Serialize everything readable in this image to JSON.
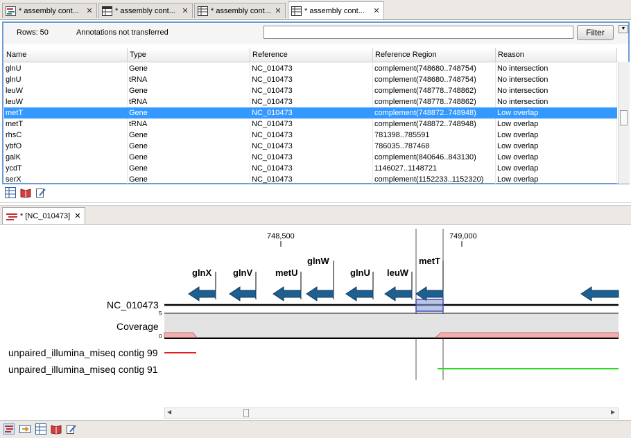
{
  "tabs": [
    {
      "label": "* assembly cont...",
      "icon": "assembly-icon"
    },
    {
      "label": "* assembly cont...",
      "icon": "table-icon"
    },
    {
      "label": "* assembly cont...",
      "icon": "table-icon"
    },
    {
      "label": "* assembly cont...",
      "icon": "table-icon"
    }
  ],
  "toolbar": {
    "rows": "Rows: 50",
    "annotations": "Annotations not transferred",
    "filter_value": "",
    "filter_label": "Filter",
    "menu_glyph": "▼"
  },
  "table": {
    "columns": [
      "Name",
      "Type",
      "Reference",
      "Reference Region",
      "Reason"
    ],
    "rows": [
      [
        "glnU",
        "Gene",
        "NC_010473",
        "complement(748680..748754)",
        "No intersection"
      ],
      [
        "glnU",
        "tRNA",
        "NC_010473",
        "complement(748680..748754)",
        "No intersection"
      ],
      [
        "leuW",
        "Gene",
        "NC_010473",
        "complement(748778..748862)",
        "No intersection"
      ],
      [
        "leuW",
        "tRNA",
        "NC_010473",
        "complement(748778..748862)",
        "No intersection"
      ],
      [
        "metT",
        "Gene",
        "NC_010473",
        "complement(748872..748948)",
        "Low overlap"
      ],
      [
        "metT",
        "tRNA",
        "NC_010473",
        "complement(748872..748948)",
        "Low overlap"
      ],
      [
        "rhsC",
        "Gene",
        "NC_010473",
        "781398..785591",
        "Low overlap"
      ],
      [
        "ybfO",
        "Gene",
        "NC_010473",
        "786035..787468",
        "Low overlap"
      ],
      [
        "galK",
        "Gene",
        "NC_010473",
        "complement(840646..843130)",
        "Low overlap"
      ],
      [
        "ycdT",
        "Gene",
        "NC_010473",
        "1146027..1148721",
        "Low overlap"
      ],
      [
        "serX",
        "Gene",
        "NC_010473",
        "complement(1152233..1152320)",
        "Low overlap"
      ]
    ],
    "selected_row": 4
  },
  "track_tab": {
    "label": "* [NC_010473]"
  },
  "viewer": {
    "ruler": [
      "748,500",
      "749,000"
    ],
    "genes": [
      "glnX",
      "glnV",
      "metU",
      "glnW",
      "glnU",
      "leuW",
      "metT"
    ],
    "reference_label": "NC_010473",
    "coverage_label": "Coverage",
    "coverage_max": "5",
    "coverage_min": "0",
    "contigs": [
      "unpaired_illumina_miseq contig 99",
      "unpaired_illumina_miseq contig 91"
    ],
    "colors": {
      "gene": "#1f5f8f",
      "contig99": "#e02020",
      "contig91": "#22dd22",
      "coverage": "#f4b0b0",
      "selection": "#3399ff"
    }
  }
}
